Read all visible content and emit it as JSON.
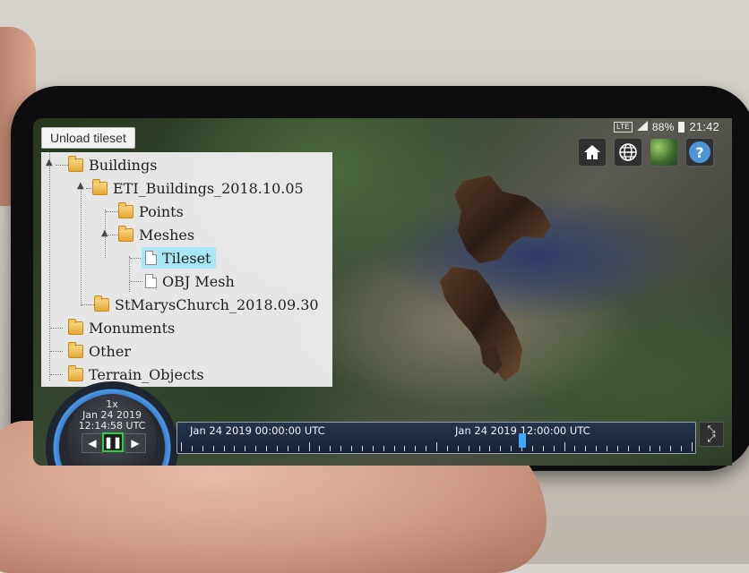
{
  "status_bar": {
    "network": "LTE",
    "battery": "88%",
    "time": "21:42"
  },
  "toolbar": {
    "unload_label": "Unload tileset",
    "right_buttons": [
      {
        "name": "home-button",
        "icon": "home-icon"
      },
      {
        "name": "globe-button",
        "icon": "globe-icon"
      },
      {
        "name": "imagery-button",
        "icon": "satellite-imagery-icon"
      },
      {
        "name": "help-button",
        "icon": "help-icon",
        "glyph": "?"
      }
    ]
  },
  "tree": {
    "items": [
      {
        "label": "Buildings",
        "type": "folder",
        "level": 0
      },
      {
        "label": "ETI_Buildings_2018.10.05",
        "type": "folder",
        "level": 1
      },
      {
        "label": "Points",
        "type": "folder",
        "level": 2
      },
      {
        "label": "Meshes",
        "type": "folder",
        "level": 2
      },
      {
        "label": "Tileset",
        "type": "file",
        "level": 3,
        "selected": true
      },
      {
        "label": "OBJ Mesh",
        "type": "file",
        "level": 3
      },
      {
        "label": "StMarysChurch_2018.09.30",
        "type": "folder",
        "level": 1
      },
      {
        "label": "Monuments",
        "type": "folder",
        "level": 0
      },
      {
        "label": "Other",
        "type": "folder",
        "level": 0
      },
      {
        "label": "Terrain_Objects",
        "type": "folder",
        "level": 0
      }
    ],
    "selected_color": "#a9e6f5"
  },
  "animation": {
    "speed": "1x",
    "date": "Jan 24 2019",
    "time": "12:14:58 UTC",
    "play_state": "paused"
  },
  "timeline": {
    "start_label": "Jan 24 2019 00:00:00 UTC",
    "mid_label": "Jan 24 2019 12:00:00 UTC",
    "current_time": "12:14:58"
  },
  "colors": {
    "accent_blue": "#4a9ae7",
    "play_green": "#2bd243",
    "help_blue": "#4d95d7"
  }
}
